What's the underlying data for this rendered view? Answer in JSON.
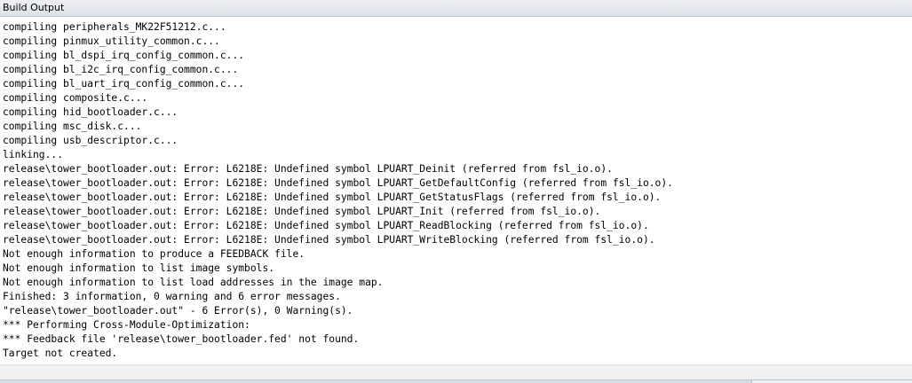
{
  "window": {
    "title": "Build Output"
  },
  "output": {
    "lines": [
      "compiling peripherals_MK22F51212.c...",
      "compiling pinmux_utility_common.c...",
      "compiling bl_dspi_irq_config_common.c...",
      "compiling bl_i2c_irq_config_common.c...",
      "compiling bl_uart_irq_config_common.c...",
      "compiling composite.c...",
      "compiling hid_bootloader.c...",
      "compiling msc_disk.c...",
      "compiling usb_descriptor.c...",
      "linking...",
      "release\\tower_bootloader.out: Error: L6218E: Undefined symbol LPUART_Deinit (referred from fsl_io.o).",
      "release\\tower_bootloader.out: Error: L6218E: Undefined symbol LPUART_GetDefaultConfig (referred from fsl_io.o).",
      "release\\tower_bootloader.out: Error: L6218E: Undefined symbol LPUART_GetStatusFlags (referred from fsl_io.o).",
      "release\\tower_bootloader.out: Error: L6218E: Undefined symbol LPUART_Init (referred from fsl_io.o).",
      "release\\tower_bootloader.out: Error: L6218E: Undefined symbol LPUART_ReadBlocking (referred from fsl_io.o).",
      "release\\tower_bootloader.out: Error: L6218E: Undefined symbol LPUART_WriteBlocking (referred from fsl_io.o).",
      "Not enough information to produce a FEEDBACK file.",
      "Not enough information to list image symbols.",
      "Not enough information to list load addresses in the image map.",
      "Finished: 3 information, 0 warning and 6 error messages.",
      "\"release\\tower_bootloader.out\" - 6 Error(s), 0 Warning(s).",
      "*** Performing Cross-Module-Optimization:",
      "*** Feedback file 'release\\tower_bootloader.fed' not found.",
      "Target not created."
    ]
  }
}
